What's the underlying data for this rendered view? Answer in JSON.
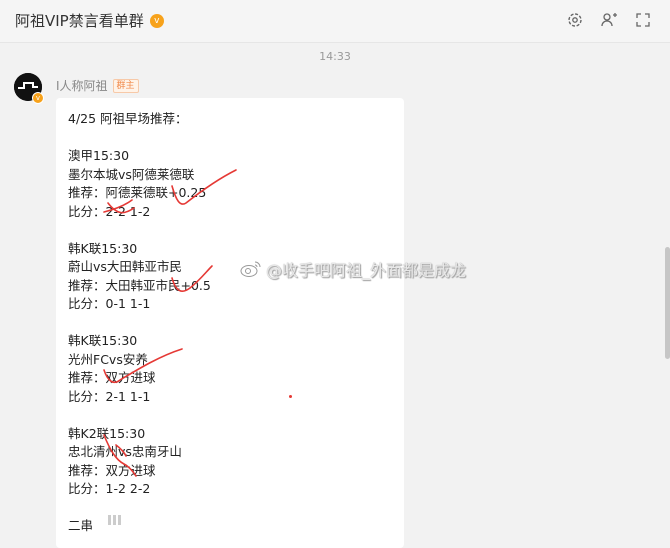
{
  "header": {
    "title": "阿祖VIP禁言看单群",
    "vip_badge": "v",
    "icons": [
      "settings-icon",
      "add-member-icon",
      "expand-icon"
    ]
  },
  "timestamp": "14:33",
  "message": {
    "sender": "I人称阿祖",
    "role": "群主",
    "lines": [
      "4/25 阿祖早场推荐：",
      "",
      "澳甲15:30",
      "墨尔本城vs阿德莱德联",
      "推荐：阿德莱德联+0.25",
      "比分：2-2 1-2",
      "",
      "韩K联15:30",
      "蔚山vs大田韩亚市民",
      "推荐：大田韩亚市民+0.5",
      "比分：0-1 1-1",
      "",
      "韩K联15:30",
      "光州FCvs安养",
      "推荐：双方进球",
      "比分：2-1 1-1",
      "",
      "韩K2联15:30",
      "忠北清州vs忠南牙山",
      "推荐：双方进球",
      "比分：1-2 2-2",
      "",
      "二串"
    ]
  },
  "watermark": "@收手吧阿祖_外面都是成龙",
  "colors": {
    "accent": "#f7a21b",
    "mark": "#e53935"
  }
}
